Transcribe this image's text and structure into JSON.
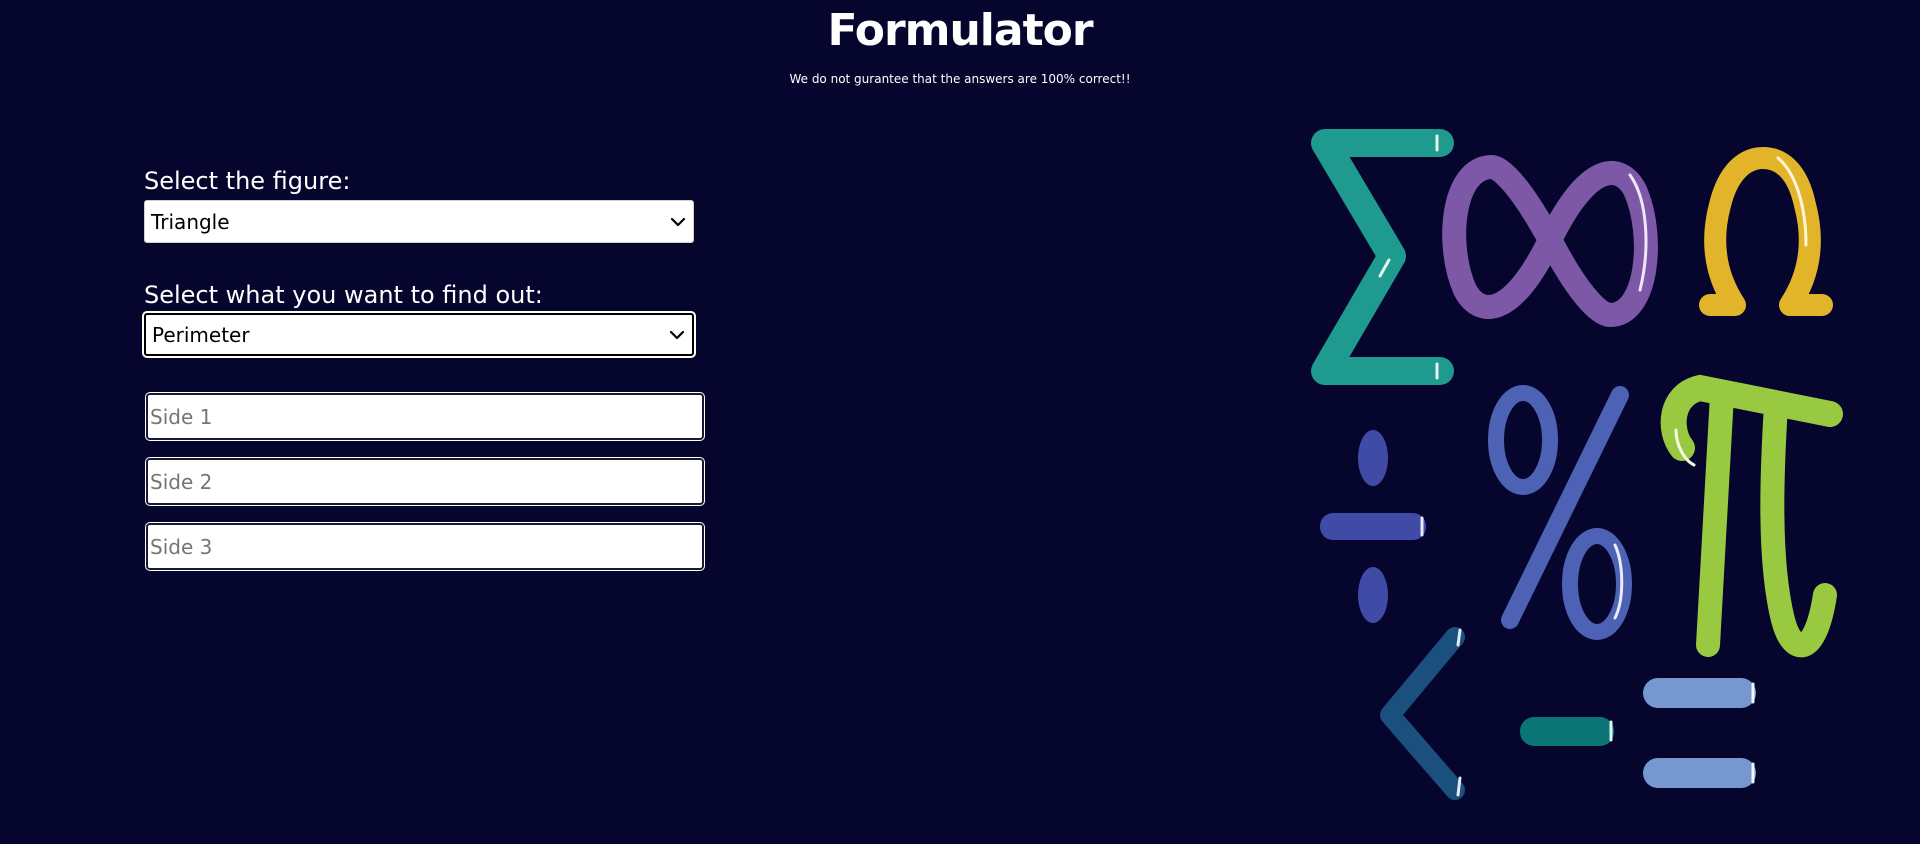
{
  "header": {
    "title": "Formulator",
    "subtitle": "We do not gurantee that the answers are 100% correct!!"
  },
  "form": {
    "figure_label": "Select the figure:",
    "figure_value": "Triangle",
    "find_label": "Select what you want to find out:",
    "find_value": "Perimeter",
    "inputs": [
      {
        "placeholder": "Side 1",
        "value": ""
      },
      {
        "placeholder": "Side 2",
        "value": ""
      },
      {
        "placeholder": "Side 3",
        "value": ""
      }
    ]
  },
  "art": {
    "symbols": [
      "sigma-icon",
      "infinity-icon",
      "omega-icon",
      "divide-icon",
      "percent-icon",
      "pi-icon",
      "less-than-icon",
      "minus-icon",
      "equals-icon"
    ],
    "colors": {
      "sigma": "#1f9a8f",
      "infinity": "#7c58a6",
      "omega": "#e2b429",
      "divide": "#3f4ba6",
      "percent": "#4d62b4",
      "pi": "#98c940",
      "less_than": "#1a4f7e",
      "minus": "#0b7575",
      "equals": "#7797d1"
    }
  }
}
